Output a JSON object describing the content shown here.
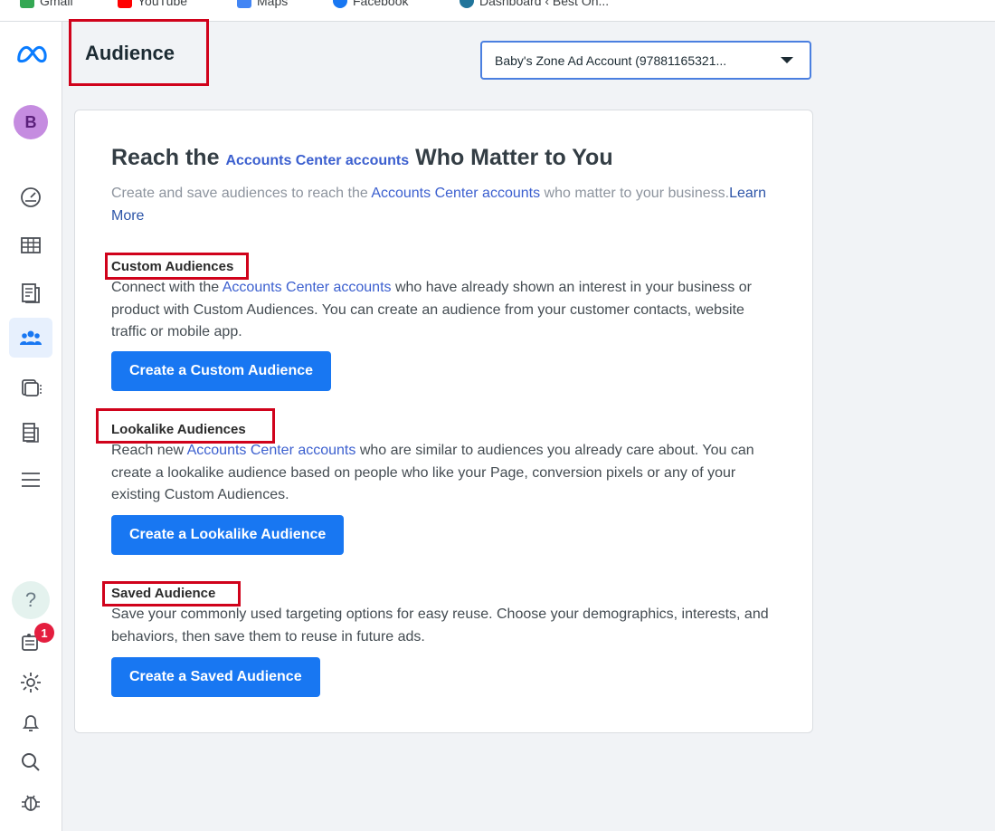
{
  "bookmarks": [
    {
      "label": "Gmail",
      "icon": "gmail-icon",
      "color": "#34a853"
    },
    {
      "label": "YouTube",
      "icon": "youtube-icon",
      "color": "#ff0000"
    },
    {
      "label": "Maps",
      "icon": "maps-icon",
      "color": "#4285f4"
    },
    {
      "label": "Facebook",
      "icon": "facebook-icon",
      "color": "#1877f2"
    },
    {
      "label": "Dashboard ‹ Best On...",
      "icon": "wordpress-icon",
      "color": "#21759b"
    }
  ],
  "sidebar": {
    "logo": "meta-logo-icon",
    "avatar_initial": "B",
    "items": [
      {
        "icon": "gauge-icon"
      },
      {
        "icon": "table-icon"
      },
      {
        "icon": "pages-icon"
      },
      {
        "icon": "audiences-icon",
        "active": true
      },
      {
        "icon": "catalog-icon"
      },
      {
        "icon": "database-icon"
      },
      {
        "icon": "hamburger-menu-icon"
      }
    ],
    "bottom": [
      {
        "icon": "help-icon",
        "glyph": "?"
      },
      {
        "icon": "notifications-icon",
        "badge": "1"
      },
      {
        "icon": "settings-gear-icon"
      },
      {
        "icon": "bell-icon"
      },
      {
        "icon": "search-icon"
      },
      {
        "icon": "bug-icon"
      }
    ]
  },
  "header": {
    "title": "Audience",
    "account_selector": "Baby's Zone Ad Account (97881165321..."
  },
  "card": {
    "headline_pre": "Reach the ",
    "headline_link": "Accounts Center accounts",
    "headline_post": " Who Matter to You",
    "intro_pre": "Create and save audiences to reach the ",
    "intro_link": "Accounts Center accounts",
    "intro_post": " who matter to your business.",
    "learn_more": "Learn More",
    "sections": [
      {
        "title": "Custom Audiences",
        "text_pre": "Connect with the ",
        "text_link": "Accounts Center accounts",
        "text_post": " who have already shown an interest in your business or product with Custom Audiences. You can create an audience from your customer contacts, website traffic or mobile app.",
        "button": "Create a Custom Audience"
      },
      {
        "title": "Lookalike Audiences",
        "text_pre": "Reach new ",
        "text_link": "Accounts Center accounts",
        "text_post": " who are similar to audiences you already care about. You can create a lookalike audience based on people who like your Page, conversion pixels or any of your existing Custom Audiences.",
        "button": "Create a Lookalike Audience"
      },
      {
        "title": "Saved Audience",
        "text": "Save your commonly used targeting options for easy reuse. Choose your demographics, interests, and behaviors, then save them to reuse in future ads.",
        "button": "Create a Saved Audience"
      }
    ]
  },
  "colors": {
    "accent": "#1877f2",
    "link": "#3b5fcf",
    "highlight_box": "#d0021b"
  }
}
